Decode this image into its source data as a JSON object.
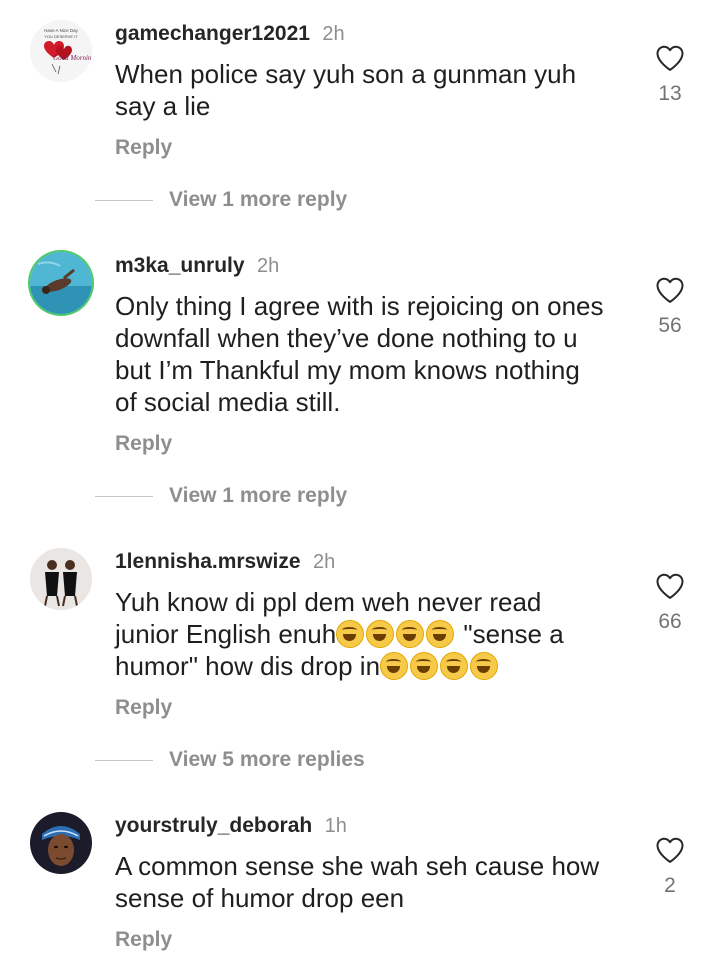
{
  "comments": [
    {
      "username": "gamechanger12021",
      "time": "2h",
      "text_lines": [
        "When police say yuh son a gunman yuh",
        "say a lie"
      ],
      "likes": "13",
      "reply_label": "Reply",
      "view_more": "View 1 more reply",
      "avatar_text": [
        "Have A Nice Day",
        "YOU DESERVE IT",
        "Good Morning"
      ],
      "avatar_icon": "heart-bouquet-avatar"
    },
    {
      "username": "m3ka_unruly",
      "time": "2h",
      "text_lines": [
        "Only thing I agree with is rejoicing on ones",
        "downfall when they’ve done nothing to u",
        "but I’m Thankful my mom knows nothing",
        "of social media still."
      ],
      "likes": "56",
      "reply_label": "Reply",
      "view_more": "View 1 more reply",
      "avatar_icon": "pool-photo-avatar"
    },
    {
      "username": "1lennisha.mrswize",
      "time": "2h",
      "text_lines": [
        "Yuh know di ppl dem weh never read",
        "junior English enuh",
        "\"sense a",
        "humor\" how dis drop in"
      ],
      "likes": "66",
      "reply_label": "Reply",
      "view_more": "View 5 more replies",
      "emoji": "grinning-sweat-emoji",
      "avatar_icon": "two-women-avatar"
    },
    {
      "username": "yourstruly_deborah",
      "time": "1h",
      "text_lines": [
        "A common sense she wah seh cause how",
        "sense of humor drop een"
      ],
      "likes": "2",
      "reply_label": "Reply",
      "avatar_icon": "selfie-avatar"
    }
  ],
  "colors": {
    "primary_text": "#262626",
    "secondary_text": "#8e8e8e",
    "avatar_ring_m3ka": "#4cc96a"
  },
  "icons": {
    "like": "heart-outline-icon"
  }
}
